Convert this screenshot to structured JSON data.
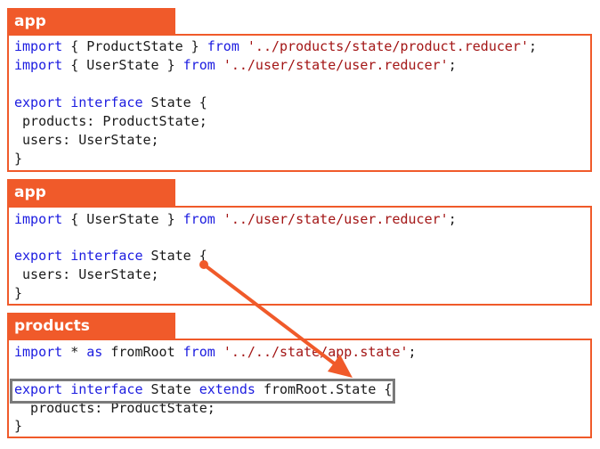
{
  "panels": [
    {
      "label": "app",
      "lines": [
        [
          {
            "t": "import",
            "c": "kw"
          },
          {
            "t": " { ProductState } "
          },
          {
            "t": "from",
            "c": "kw"
          },
          {
            "t": " "
          },
          {
            "t": "'../products/state/product.reducer'",
            "c": "str"
          },
          {
            "t": ";"
          }
        ],
        [
          {
            "t": "import",
            "c": "kw"
          },
          {
            "t": " { UserState } "
          },
          {
            "t": "from",
            "c": "kw"
          },
          {
            "t": " "
          },
          {
            "t": "'../user/state/user.reducer'",
            "c": "str"
          },
          {
            "t": ";"
          }
        ],
        [],
        [
          {
            "t": "export",
            "c": "kw"
          },
          {
            "t": " "
          },
          {
            "t": "interface",
            "c": "kw"
          },
          {
            "t": " State {"
          }
        ],
        [
          {
            "t": " products: ProductState;"
          }
        ],
        [
          {
            "t": " users: UserState;"
          }
        ],
        [
          {
            "t": "}"
          }
        ]
      ]
    },
    {
      "label": "app",
      "lines": [
        [
          {
            "t": "import",
            "c": "kw"
          },
          {
            "t": " { UserState } "
          },
          {
            "t": "from",
            "c": "kw"
          },
          {
            "t": " "
          },
          {
            "t": "'../user/state/user.reducer'",
            "c": "str"
          },
          {
            "t": ";"
          }
        ],
        [],
        [
          {
            "t": "export",
            "c": "kw"
          },
          {
            "t": " "
          },
          {
            "t": "interface",
            "c": "kw"
          },
          {
            "t": " State {"
          }
        ],
        [
          {
            "t": " users: UserState;"
          }
        ],
        [
          {
            "t": "}"
          }
        ]
      ]
    },
    {
      "label": "products",
      "lines": [
        [
          {
            "t": "import",
            "c": "kw"
          },
          {
            "t": " * "
          },
          {
            "t": "as",
            "c": "kw"
          },
          {
            "t": " fromRoot "
          },
          {
            "t": "from",
            "c": "kw"
          },
          {
            "t": " "
          },
          {
            "t": "'../../state/app.state'",
            "c": "str"
          },
          {
            "t": ";"
          }
        ],
        [],
        [
          {
            "t": "export",
            "c": "kw"
          },
          {
            "t": " "
          },
          {
            "t": "interface",
            "c": "kw"
          },
          {
            "t": " State "
          },
          {
            "t": "extends",
            "c": "kw"
          },
          {
            "t": " fromRoot.State {"
          }
        ],
        [
          {
            "t": "  products: ProductState;"
          }
        ],
        [
          {
            "t": "}"
          }
        ]
      ]
    }
  ],
  "colors": {
    "accent": "#F05A2A",
    "keyword": "#1c1ce0",
    "string": "#a31515",
    "highlight_border": "#7a7a7a"
  }
}
